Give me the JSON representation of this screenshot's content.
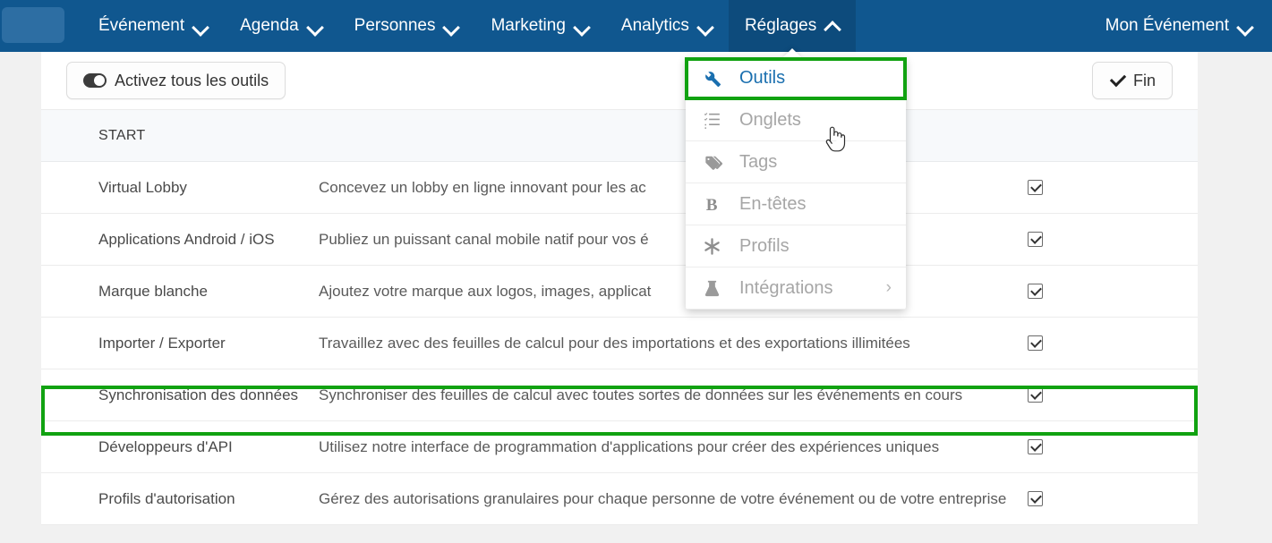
{
  "navbar": {
    "logo": "logo-placeholder",
    "items": [
      {
        "label": "Événement",
        "caret": "down",
        "active": false
      },
      {
        "label": "Agenda",
        "caret": "down",
        "active": false
      },
      {
        "label": "Personnes",
        "caret": "down",
        "active": false
      },
      {
        "label": "Marketing",
        "caret": "down",
        "active": false
      },
      {
        "label": "Analytics",
        "caret": "down",
        "active": false
      },
      {
        "label": "Réglages",
        "caret": "up",
        "active": true
      }
    ],
    "account": {
      "label": "Mon Événement",
      "caret": "down"
    },
    "background_color": "#10578f",
    "active_color": "#0d4b7c"
  },
  "dropdown": {
    "open_for": "Réglages",
    "items": [
      {
        "label": "Outils",
        "icon": "wrench-icon",
        "enabled": true,
        "chevron": false
      },
      {
        "label": "Onglets",
        "icon": "list-icon",
        "enabled": false,
        "chevron": false
      },
      {
        "label": "Tags",
        "icon": "tag-icon",
        "enabled": false,
        "chevron": false
      },
      {
        "label": "En-têtes",
        "icon": "bold-b-icon",
        "enabled": false,
        "chevron": false
      },
      {
        "label": "Profils",
        "icon": "asterisk-icon",
        "enabled": false,
        "chevron": false
      },
      {
        "label": "Intégrations",
        "icon": "flask-icon",
        "enabled": false,
        "chevron": true,
        "chevron_glyph": "›"
      }
    ],
    "highlighted_item": "Outils",
    "highlight_color": "#11a211"
  },
  "toolbar": {
    "enable_all_label": "Activez tous les outils",
    "enable_all_icon": "toggle-icon",
    "done_label": "Fin",
    "done_icon": "check-icon"
  },
  "table": {
    "section_label": "START",
    "rows": [
      {
        "name": "Virtual Lobby",
        "description": "Concevez un lobby en ligne innovant pour les ac",
        "checked": true
      },
      {
        "name": "Applications Android / iOS",
        "description": "Publiez un puissant canal mobile natif pour vos é",
        "checked": true
      },
      {
        "name": "Marque blanche",
        "description": "Ajoutez votre marque aux logos, images, applicat",
        "checked": true
      },
      {
        "name": "Importer / Exporter",
        "description": "Travaillez avec des feuilles de calcul pour des importations et des exportations illimitées",
        "checked": true
      },
      {
        "name": "Synchronisation des données",
        "description": "Synchroniser des feuilles de calcul avec toutes sortes de données sur les événements en cours",
        "checked": true,
        "highlighted": true
      },
      {
        "name": "Développeurs d'API",
        "description": "Utilisez notre interface de programmation d'applications pour créer des expériences uniques",
        "checked": true
      },
      {
        "name": "Profils d'autorisation",
        "description": "Gérez des autorisations granulaires pour chaque personne de votre événement ou de votre entreprise",
        "checked": true
      }
    ],
    "highlight_color": "#11a211"
  },
  "cursor": {
    "type": "pointing-hand-cursor"
  }
}
